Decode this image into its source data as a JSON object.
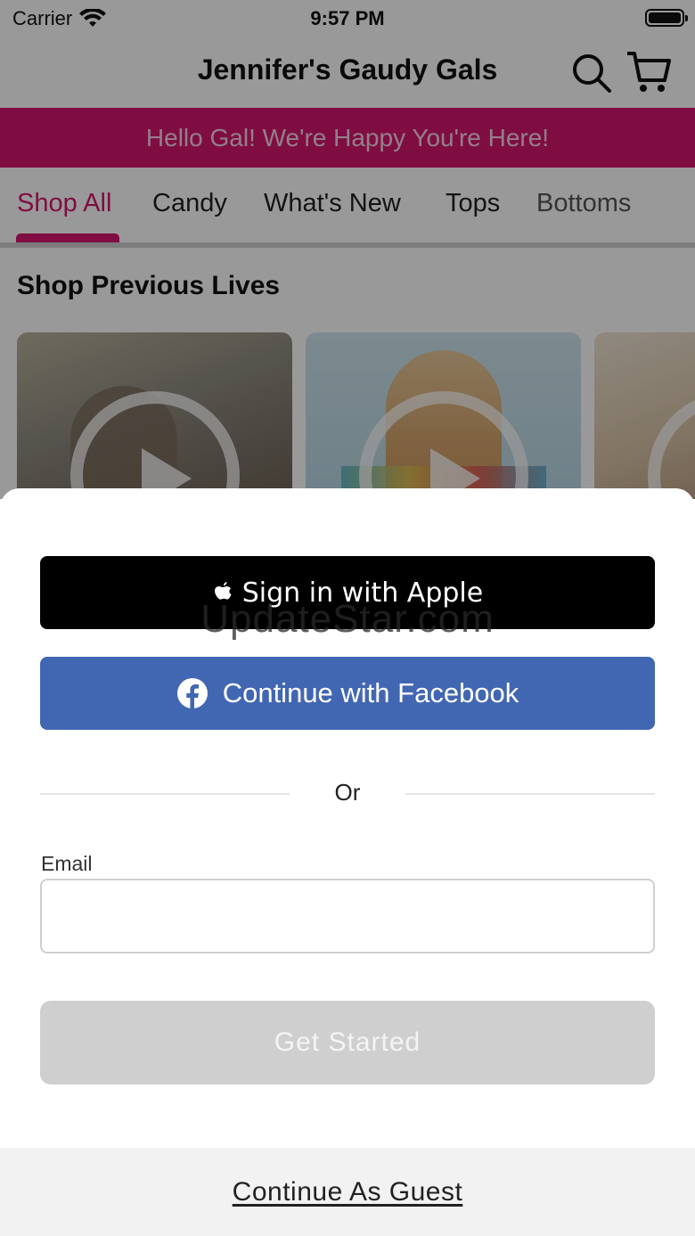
{
  "status_bar": {
    "carrier": "Carrier",
    "time": "9:57 PM"
  },
  "header": {
    "title": "Jennifer's Gaudy Gals",
    "search_icon": "search-icon",
    "cart_icon": "cart-icon"
  },
  "banner": {
    "text": "Hello Gal! We're Happy You're Here!",
    "color": "#d4176f"
  },
  "nav": {
    "tabs": [
      {
        "label": "Shop All",
        "active": true
      },
      {
        "label": "Candy"
      },
      {
        "label": "What's New"
      },
      {
        "label": "Tops"
      },
      {
        "label": "Bottoms"
      }
    ]
  },
  "section": {
    "title": "Shop Previous Lives"
  },
  "sheet": {
    "apple_label": "Sign in with Apple",
    "watermark": "UpdateStar.com",
    "facebook_label": "Continue with Facebook",
    "facebook_color": "#4267b2",
    "or_text": "Or",
    "email_label": "Email",
    "email_value": "",
    "get_started_label": "Get Started",
    "guest_label": "Continue As Guest"
  }
}
